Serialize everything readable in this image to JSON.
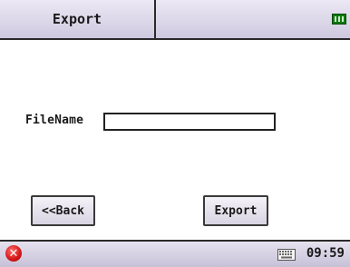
{
  "titlebar": {
    "title": "Export",
    "battery_icon": "battery-full-icon",
    "battery_color": "#0f7a0f"
  },
  "form": {
    "filename_label": "FileName",
    "filename_value": ""
  },
  "buttons": {
    "back_label": "<<Back",
    "export_label": "Export"
  },
  "taskbar": {
    "close_icon": "close-icon",
    "close_color": "#d41515",
    "keyboard_icon": "keyboard-icon",
    "time": "09:59"
  }
}
